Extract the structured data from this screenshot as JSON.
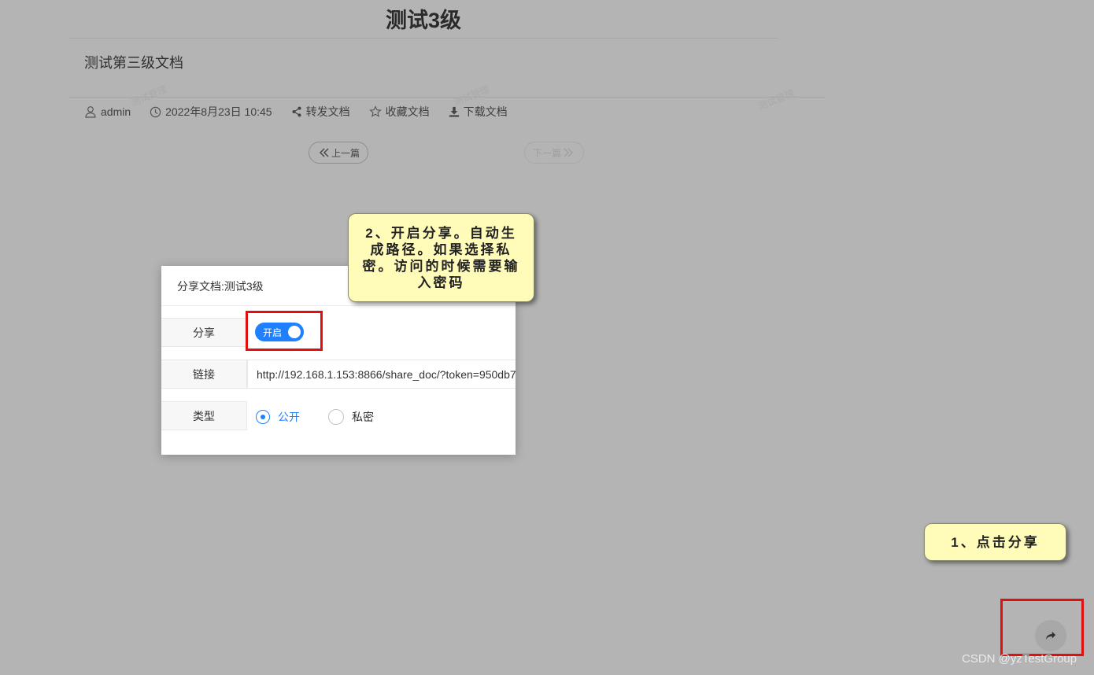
{
  "document": {
    "title": "测试3级",
    "body": "测试第三级文档",
    "watermark": "测试管理",
    "meta": {
      "author": "admin",
      "datetime": "2022年8月23日 10:45",
      "forward": "转发文档",
      "favorite": "收藏文档",
      "download": "下载文档"
    },
    "pager": {
      "prev": "上一篇",
      "next": "下一篇"
    }
  },
  "share_dialog": {
    "title": "分享文档:测试3级",
    "share_label": "分享",
    "toggle_text": "开启",
    "toggle_on": true,
    "link_label": "链接",
    "link_value": "http://192.168.1.153:8866/share_doc/?token=950db7",
    "type_label": "类型",
    "type_options": [
      "公开",
      "私密"
    ],
    "type_selected": "公开"
  },
  "annotations": {
    "step2": "2、开启分享。自动生成路径。如果选择私密。访问的时候需要输入密码",
    "step1": "1、点击分享"
  },
  "footer": {
    "watermark": "CSDN @yzTestGroup"
  },
  "colors": {
    "accent": "#1e80ff",
    "highlight": "#e01010",
    "callout_bg": "#fffbb9",
    "overlay": "#b4b4b4"
  },
  "icons": {
    "author": "user-icon",
    "datetime": "clock-icon",
    "forward": "share-nodes-icon",
    "favorite": "star-icon",
    "download": "download-icon",
    "fab": "share-arrow-icon"
  }
}
